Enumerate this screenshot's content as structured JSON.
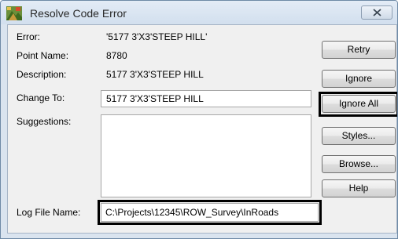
{
  "window": {
    "title": "Resolve Code Error"
  },
  "fields": {
    "error": {
      "label": "Error:",
      "value": "'5177 3'X3'STEEP HILL'"
    },
    "point_name": {
      "label": "Point Name:",
      "value": "8780"
    },
    "description": {
      "label": "Description:",
      "value": "5177 3'X3'STEEP HILL"
    },
    "change_to": {
      "label": "Change To:",
      "value": "5177 3'X3'STEEP HILL"
    },
    "suggestions": {
      "label": "Suggestions:"
    },
    "log_file": {
      "label": "Log File Name:",
      "value": "C:\\Projects\\12345\\ROW_Survey\\InRoads"
    }
  },
  "buttons": {
    "retry": "Retry",
    "ignore": "Ignore",
    "ignore_all": "Ignore All",
    "styles": "Styles...",
    "browse": "Browse...",
    "help": "Help"
  },
  "icons": {
    "app": "inroads-app-icon",
    "close": "close-icon"
  },
  "colors": {
    "highlight": "#000000",
    "titlebar": "#dae4ef"
  }
}
